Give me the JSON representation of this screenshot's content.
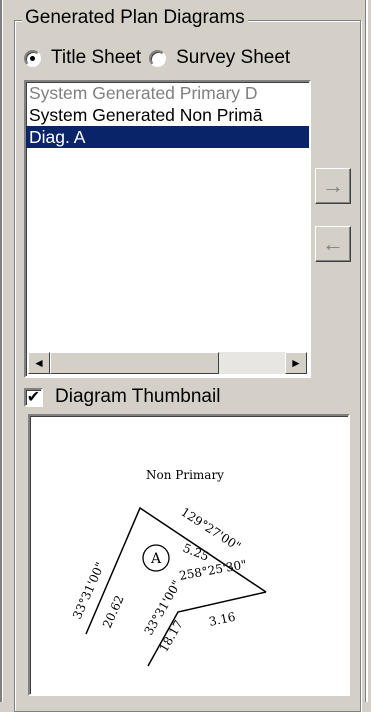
{
  "group": {
    "title": "Generated Plan Diagrams"
  },
  "sheet_options": [
    {
      "label": "Title Sheet",
      "checked": true
    },
    {
      "label": "Survey Sheet",
      "checked": false
    }
  ],
  "diagram_list": [
    {
      "label": "System Generated Primary D",
      "state": "disabled"
    },
    {
      "label": "System Generated Non Primā",
      "state": "normal"
    },
    {
      "label": "Diag. A",
      "state": "selected"
    }
  ],
  "buttons": {
    "move_right": "→",
    "move_left": "←"
  },
  "scroll": {
    "left_arrow": "◄",
    "right_arrow": "►"
  },
  "thumbnail": {
    "show_label": "Diagram Thumbnail",
    "checked": true,
    "checkmark": "✔",
    "diagram": {
      "title": "Non Primary",
      "circle_label": "A",
      "labels": [
        "33°31'00\"",
        "20.62",
        "129°27'00\"",
        "5.25",
        "258°25'30\"",
        "33°31'00\"",
        "18.17",
        "3.16"
      ]
    }
  }
}
